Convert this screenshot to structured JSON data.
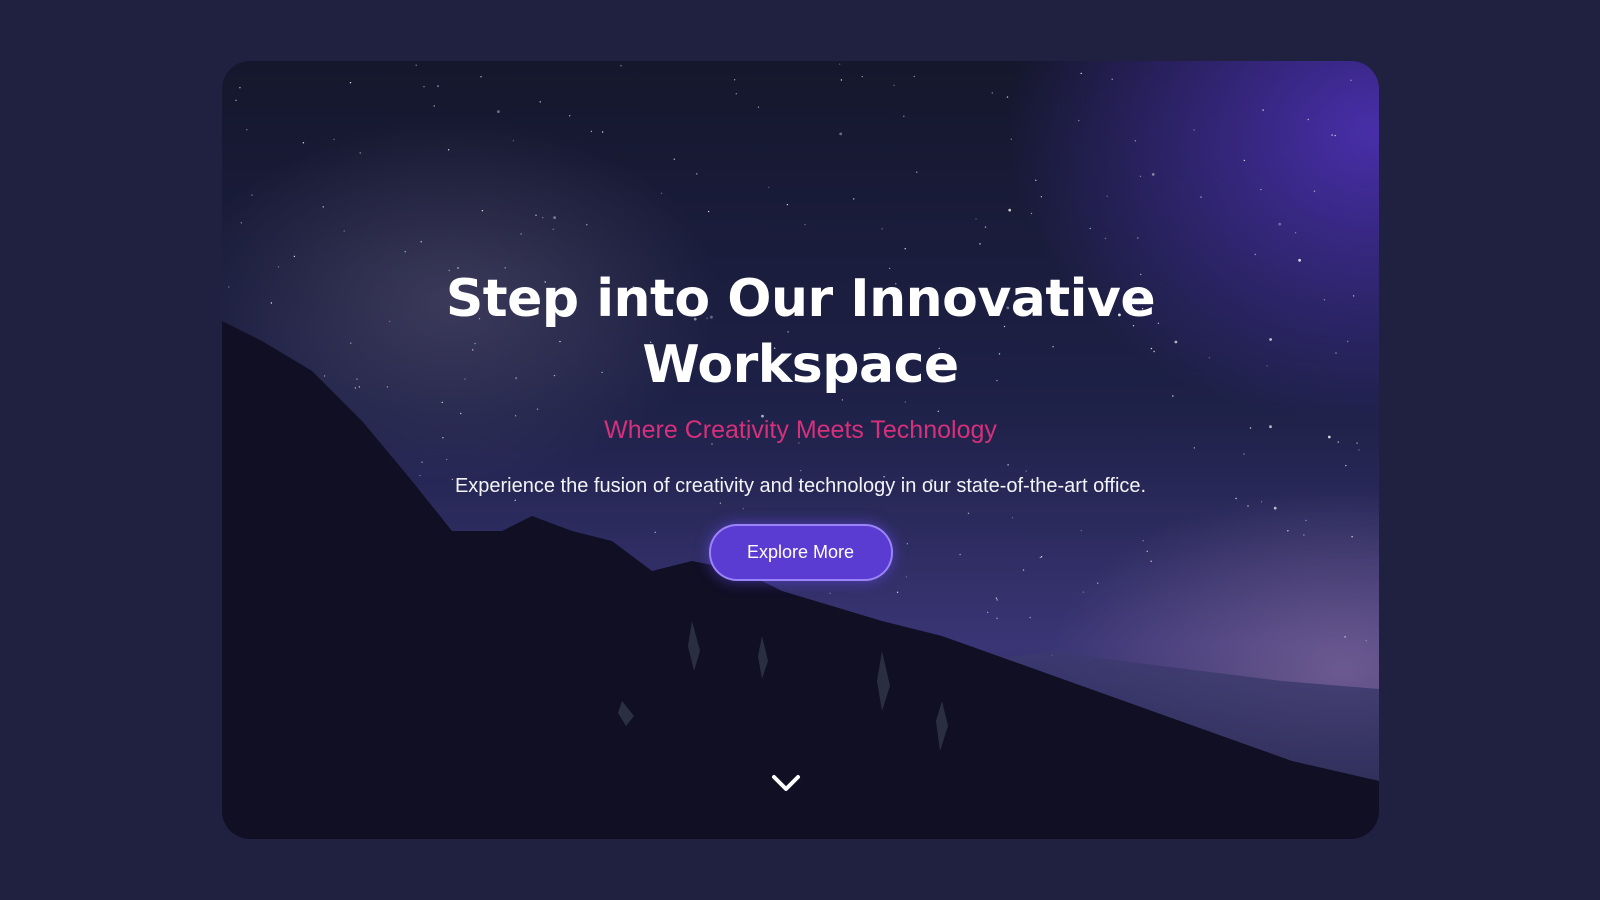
{
  "hero": {
    "title": "Step into Our Innovative Workspace",
    "subtitle": "Where Creativity Meets Technology",
    "description": "Experience the fusion of creativity and technology in our state-of-the-art office.",
    "cta_label": "Explore More",
    "scroll_icon": "chevron-down-icon"
  },
  "colors": {
    "page_background": "#202040",
    "subtitle": "#d6307a",
    "button": "#5a3cd2"
  }
}
